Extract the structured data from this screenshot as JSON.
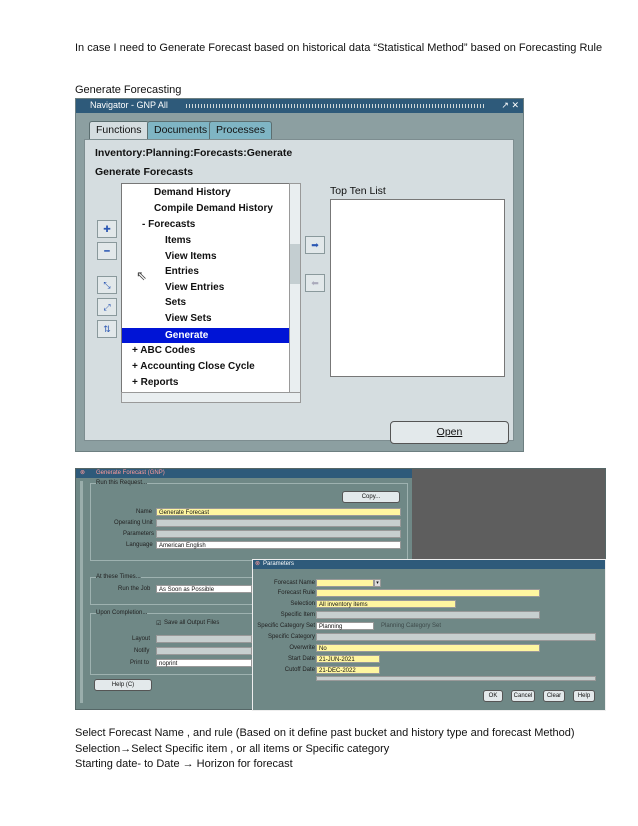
{
  "intro": "In case I need to Generate Forecast based on historical data “Statistical Method” based on Forecasting Rule",
  "section_title": "Generate Forecasting",
  "navigator": {
    "title": "Navigator - GNP All",
    "title_controls": "↗ ✕",
    "tabs": [
      "Functions",
      "Documents",
      "Processes"
    ],
    "path": "Inventory:Planning:Forecasts:Generate",
    "subtitle": "Generate Forecasts",
    "tree": [
      {
        "label": "Demand History",
        "level": 1
      },
      {
        "label": "Compile Demand History",
        "level": 1
      },
      {
        "label": "-  Forecasts",
        "level": 0
      },
      {
        "label": "Items",
        "level": 2
      },
      {
        "label": "View Items",
        "level": 2
      },
      {
        "label": "Entries",
        "level": 2
      },
      {
        "label": "View Entries",
        "level": 2
      },
      {
        "label": "Sets",
        "level": 2
      },
      {
        "label": "View Sets",
        "level": 2
      },
      {
        "label": "Generate",
        "level": 2,
        "selected": true
      },
      {
        "label": "+  ABC Codes",
        "level": -1
      },
      {
        "label": "+  Accounting Close Cycle",
        "level": -1
      },
      {
        "label": "+  Reports",
        "level": -1
      }
    ],
    "top_ten_label": "Top Ten List",
    "open_button": "Open"
  },
  "request": {
    "title": "Generate Forecast (GNP)",
    "run_this_request": "Run this Request...",
    "copy_button": "Copy...",
    "name_label": "Name",
    "name_value": "Generate Forecast",
    "operating_unit_label": "Operating Unit",
    "parameters_label": "Parameters",
    "language_label": "Language",
    "language_value": "American English",
    "at_these_times": "At these Times...",
    "run_job_label": "Run the Job",
    "run_job_value": "As Soon as Possible",
    "upon_completion": "Upon Completion...",
    "save_output": "Save all Output Files",
    "layout_label": "Layout",
    "notify_label": "Notify",
    "print_to_label": "Print to",
    "print_to_value": "noprint",
    "help_button": "Help (C)"
  },
  "parameters": {
    "title": "Parameters",
    "fields": [
      {
        "label": "Forecast Name",
        "value": "",
        "style": "yellow-short"
      },
      {
        "label": "Forecast Rule",
        "value": "",
        "style": "yellow"
      },
      {
        "label": "Selection",
        "value": "All inventory items",
        "style": "yellow-mid"
      },
      {
        "label": "Specific Item",
        "value": "",
        "style": "grey"
      },
      {
        "label": "Specific Category Set",
        "value": "Planning",
        "style": "white-short",
        "extra": "Planning Category Set"
      },
      {
        "label": "Specific Category",
        "value": "",
        "style": "grey"
      },
      {
        "label": "Overwrite",
        "value": "No",
        "style": "yellow"
      },
      {
        "label": "Start Date",
        "value": "21-JUN-2021",
        "style": "yellow-short"
      },
      {
        "label": "Cutoff Date",
        "value": "21-DEC-2022",
        "style": "yellow-short"
      }
    ],
    "buttons": [
      "OK",
      "Cancel",
      "Clear",
      "Help"
    ]
  },
  "notes": [
    "Select Forecast Name , and rule (Based on it define past bucket and history type and forecast Method)",
    "Selection→Select Specific item , or all items or Specific category",
    "Starting date- to Date → Horizon for forecast"
  ],
  "colors": {
    "title_bar": "#2e5a7a",
    "selection": "#0014d6",
    "field_yellow": "#fff6a0",
    "form_bg": "#6f8886"
  }
}
